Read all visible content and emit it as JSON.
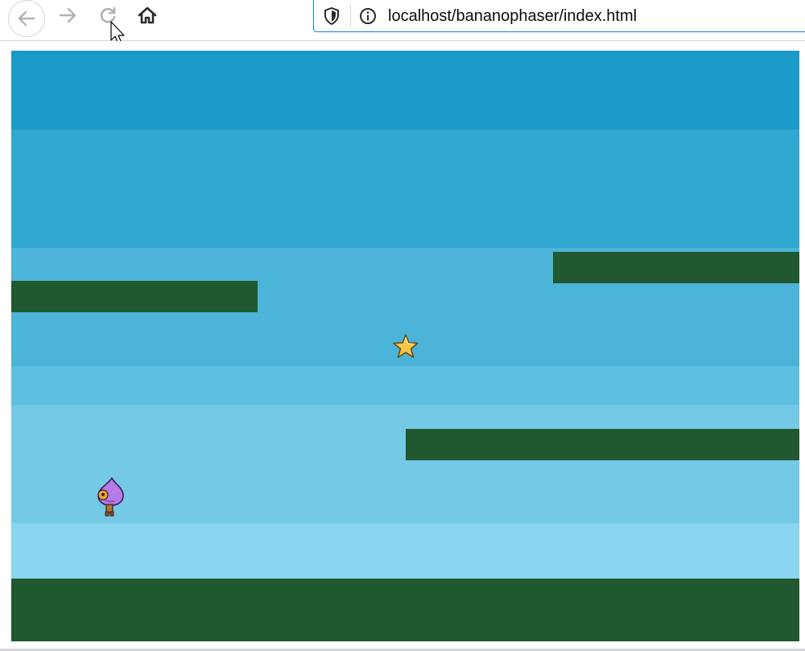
{
  "browser": {
    "url": "localhost/bananophaser/index.html",
    "icons": {
      "back": "arrow-left-icon",
      "forward": "arrow-right-icon",
      "reload": "reload-icon",
      "home": "home-icon",
      "tracking_protection": "shield-icon",
      "site_info": "info-icon"
    }
  },
  "game": {
    "sky_colors": [
      "#1a9ac6",
      "#30a7cf",
      "#4cb4d8",
      "#5ebfe0",
      "#73c9e6",
      "#89d4ee"
    ],
    "platform_color": "#205830",
    "objects": {
      "collectible": "star-icon",
      "player": "purple-drop-character"
    }
  }
}
